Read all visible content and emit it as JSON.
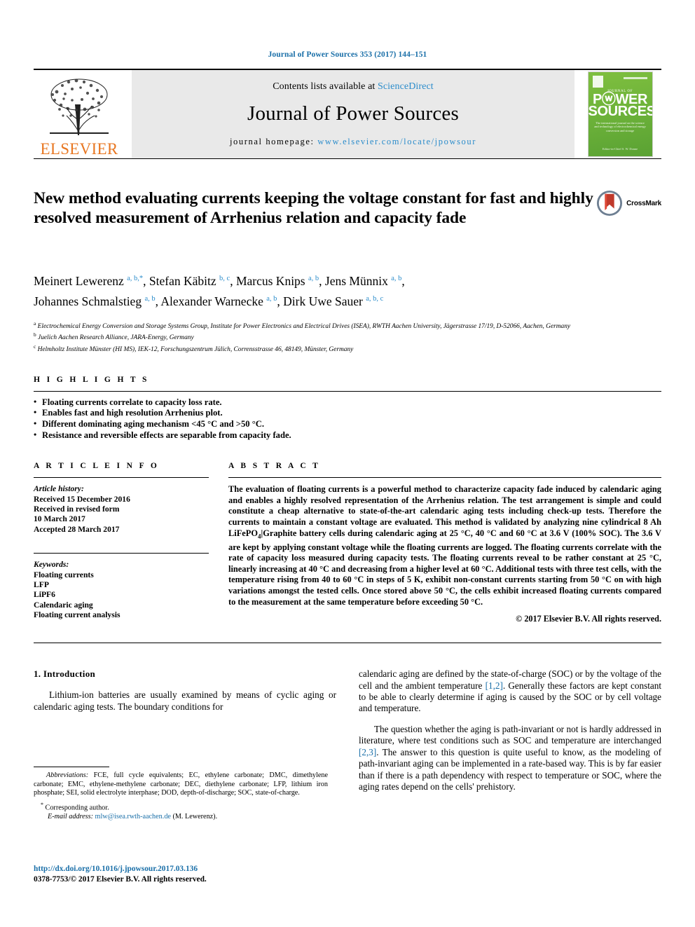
{
  "running_head": "Journal of Power Sources 353 (2017) 144–151",
  "masthead": {
    "publisher_name": "ELSEVIER",
    "contents_prefix": "Contents lists available at ",
    "contents_link": "ScienceDirect",
    "journal_name": "Journal of Power Sources",
    "homepage_prefix": "journal homepage: ",
    "homepage_url": "www.elsevier.com/locate/jpowsour",
    "cover": {
      "kicker": "JOURNAL OF",
      "title_line1": "PⓦWER",
      "title_line2": "SOURCES",
      "subtitle": "The international journal on the science and technology of electrochemical energy conversion and storage",
      "footer": "Editor-in-Chief\nS. W. Donne"
    }
  },
  "title": "New method evaluating currents keeping the voltage constant for fast and highly resolved measurement of Arrhenius relation and capacity fade",
  "crossmark_label": "CrossMark",
  "authors_html": "Meinert Lewerenz <sup class=\"sup\">a, b,</sup><sup class=\"sup-star\">*</sup>, Stefan Käbitz <sup class=\"sup\">b, c</sup>, Marcus Knips <sup class=\"sup\">a, b</sup>, Jens Münnix <sup class=\"sup\">a, b</sup>,<br>Johannes Schmalstieg <sup class=\"sup\">a, b</sup>, Alexander Warnecke <sup class=\"sup\">a, b</sup>, Dirk Uwe Sauer <sup class=\"sup\">a, b, c</sup>",
  "affiliations": [
    {
      "label": "a",
      "text": "Electrochemical Energy Conversion and Storage Systems Group, Institute for Power Electronics and Electrical Drives (ISEA), RWTH Aachen University, Jägerstrasse 17/19, D-52066, Aachen, Germany"
    },
    {
      "label": "b",
      "text": "Juelich Aachen Research Alliance, JARA-Energy, Germany"
    },
    {
      "label": "c",
      "text": "Helmholtz Institute Münster (HI MS), IEK-12, Forschungszentrum Jülich, Corrensstrasse 46, 48149, Münster, Germany"
    }
  ],
  "highlights": {
    "heading": "H I G H L I G H T S",
    "items": [
      "Floating currents correlate to capacity loss rate.",
      "Enables fast and high resolution Arrhenius plot.",
      "Different dominating aging mechanism <45 °C and >50 °C.",
      "Resistance and reversible effects are separable from capacity fade."
    ]
  },
  "article_info": {
    "heading": "A R T I C L E   I N F O",
    "history_label": "Article history:",
    "history_lines": [
      "Received 15 December 2016",
      "Received in revised form",
      "10 March 2017",
      "Accepted 28 March 2017"
    ],
    "keywords_label": "Keywords:",
    "keywords": [
      "Floating currents",
      "LFP",
      "LiPF6",
      "Calendaric aging",
      "Floating current analysis"
    ]
  },
  "abstract": {
    "heading": "A B S T R A C T",
    "text_html": "The evaluation of floating currents is a powerful method to characterize capacity fade induced by calendaric aging and enables a highly resolved representation of the Arrhenius relation. The test arrangement is simple and could constitute a cheap alternative to state-of-the-art calendaric aging tests including check-up tests. Therefore the currents to maintain a constant voltage are evaluated. This method is validated by analyzing nine cylindrical 8 Ah LiFePO<span class=\"sub\">4</span>|Graphite battery cells during calendaric aging at 25 °C, 40 °C and 60 °C at 3.6 V (100% SOC). The 3.6 V are kept by applying constant voltage while the floating currents are logged. The floating currents correlate with the rate of capacity loss measured during capacity tests. The floating currents reveal to be rather constant at 25 °C, linearly increasing at 40 °C and decreasing from a higher level at 60 °C. Additional tests with three test cells, with the temperature rising from 40 to 60 °C in steps of 5 K, exhibit non-constant currents starting from 50 °C on with high variations amongst the tested cells. Once stored above 50 °C, the cells exhibit increased floating currents compared to the measurement at the same temperature before exceeding 50 °C.",
    "copyright": "© 2017 Elsevier B.V. All rights reserved."
  },
  "body": {
    "section_number_title": "1.  Introduction",
    "left_paragraph_html": "Lithium-ion batteries are usually examined by means of cyclic aging or calendaric aging tests. The boundary conditions for",
    "right_paragraphs_html": [
      "calendaric aging are defined by the state-of-charge (SOC) or by the voltage of the cell and the ambient temperature <span class=\"ref\">[1,2]</span>. Generally these factors are kept constant to be able to clearly determine if aging is caused by the SOC or by cell voltage and temperature.",
      "The question whether the aging is path-invariant or not is hardly addressed in literature, where test conditions such as SOC and temperature are interchanged <span class=\"ref\">[2,3]</span>. The answer to this question is quite useful to know, as the modeling of path-invariant aging can be implemented in a rate-based way. This is by far easier than if there is a path dependency with respect to temperature or SOC, where the aging rates depend on the cells' prehistory."
    ]
  },
  "footnotes": {
    "abbreviations_html": "<span class=\"it\">Abbreviations:</span> FCE, full cycle equivalents; EC, ethylene carbonate; DMC, dimethylene carbonate; EMC, ethylene-methylene carbonate; DEC, diethylene carbonate; LFP, lithium iron phosphate; SEI, solid electrolyte interphase; DOD, depth-of-discharge; SOC, state-of-charge.",
    "corresponding_author": "Corresponding author.",
    "email_label": "E-mail address:",
    "email": "mlw@isea.rwth-aachen.de",
    "email_suffix": "(M. Lewerenz)."
  },
  "doi_url": "http://dx.doi.org/10.1016/j.jpowsour.2017.03.136",
  "issn_line": "0378-7753/© 2017 Elsevier B.V. All rights reserved.",
  "colors": {
    "link_blue": "#1a6fa8",
    "sciencedirect_blue": "#2b8ccb",
    "elsevier_orange": "#E87722",
    "cover_green": "#6eb33a"
  }
}
